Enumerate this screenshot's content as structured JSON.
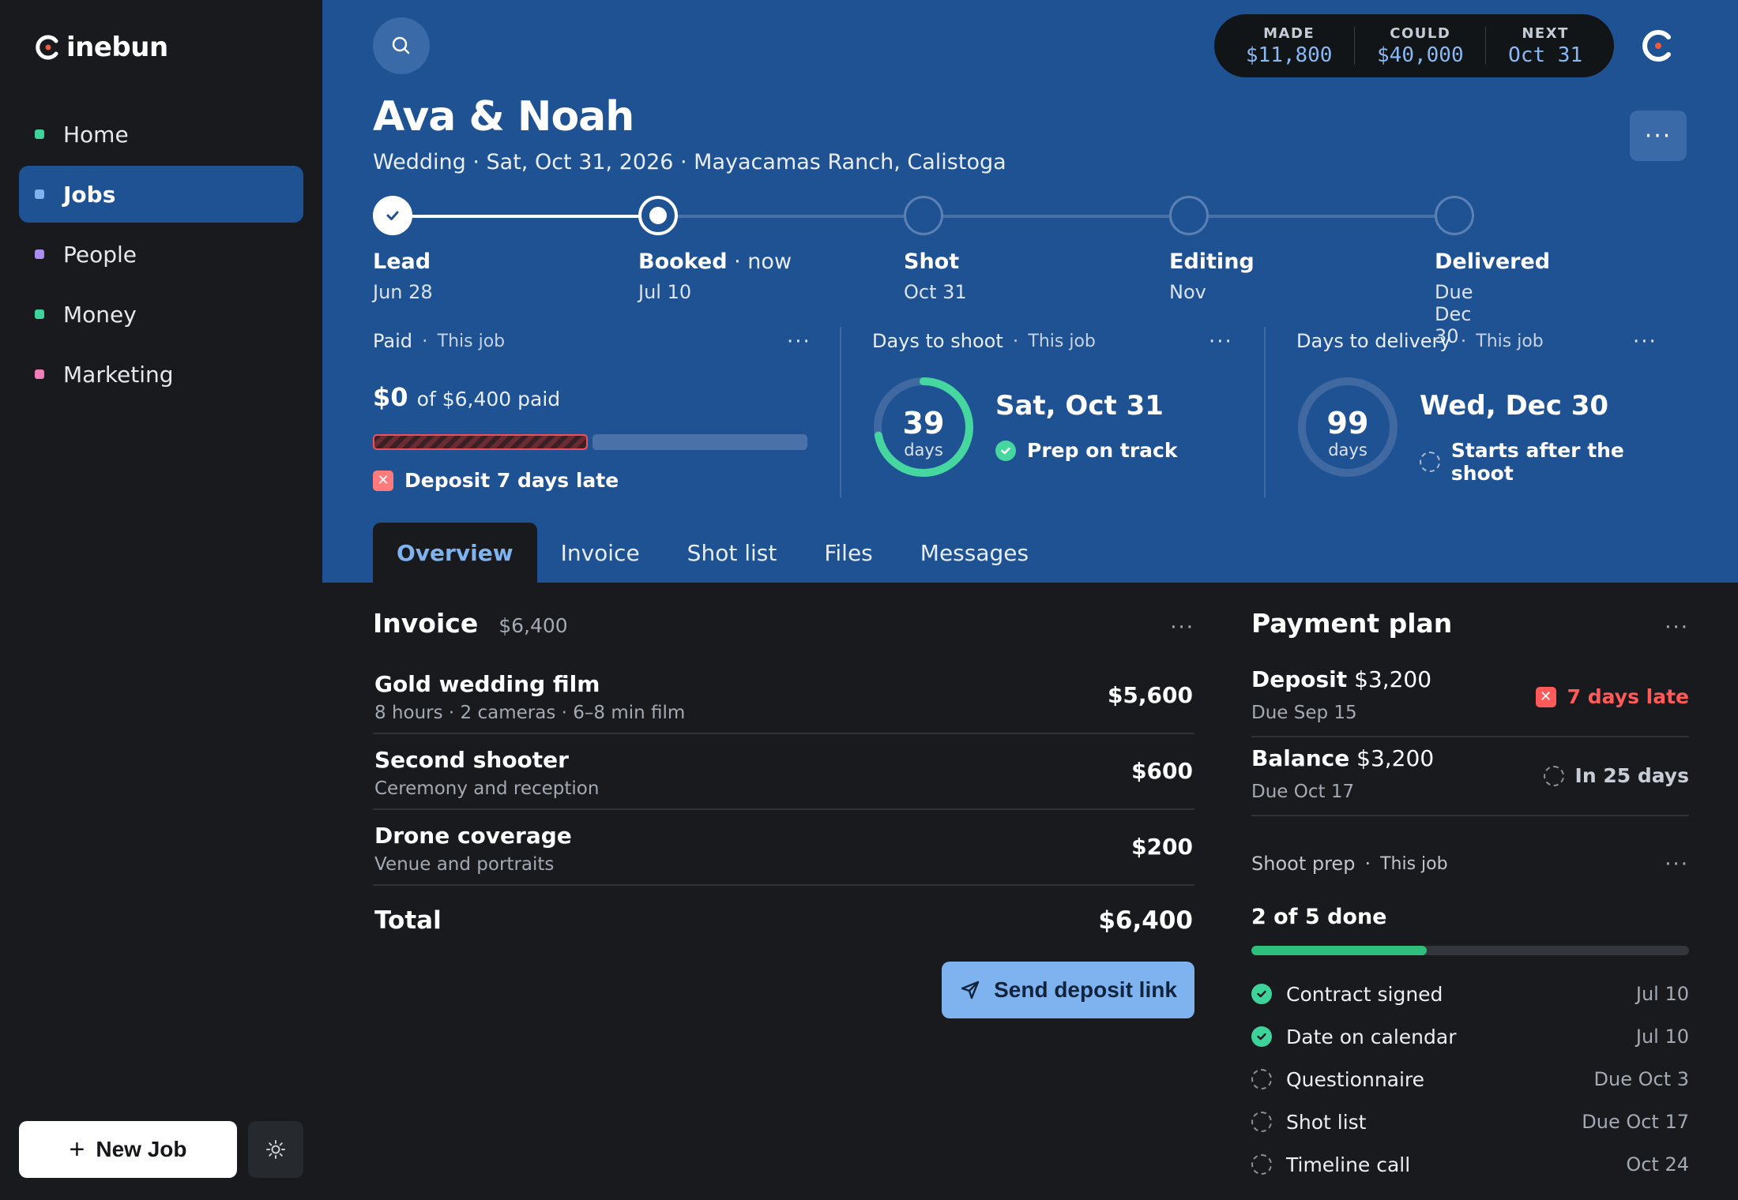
{
  "app": {
    "name": "inebun"
  },
  "sidebar": {
    "items": [
      {
        "label": "Home",
        "color": "#3ed39a",
        "active": false
      },
      {
        "label": "Jobs",
        "color": "#7fb3f0",
        "active": true
      },
      {
        "label": "People",
        "color": "#a98df0",
        "active": false
      },
      {
        "label": "Money",
        "color": "#3ed39a",
        "active": false
      },
      {
        "label": "Marketing",
        "color": "#f07fb8",
        "active": false
      }
    ],
    "new_job_label": "New Job"
  },
  "stats": {
    "made": {
      "label": "MADE",
      "value": "$11,800"
    },
    "could": {
      "label": "COULD",
      "value": "$40,000"
    },
    "next": {
      "label": "NEXT",
      "value": "Oct 31"
    }
  },
  "job": {
    "client": "Ava & Noah",
    "subtitle": "Wedding · Sat, Oct 31, 2026 · Mayacamas Ranch, Calistoga"
  },
  "steps": [
    {
      "label": "Lead",
      "suffix": "",
      "date": "Jun 28",
      "state": "done"
    },
    {
      "label": "Booked",
      "suffix": " · now",
      "date": "Jul 10",
      "state": "current"
    },
    {
      "label": "Shot",
      "suffix": "",
      "date": "Oct 31",
      "state": "todo"
    },
    {
      "label": "Editing",
      "suffix": "",
      "date": "Nov",
      "state": "todo"
    },
    {
      "label": "Delivered",
      "suffix": "",
      "date": "Due Dec 30",
      "state": "todo"
    }
  ],
  "cards": {
    "paid": {
      "title": "Paid",
      "scope": "This job",
      "amount": "$0",
      "of_text": "of $6,400 paid",
      "paid_fraction": 0,
      "late_text": "Deposit 7 days late"
    },
    "shoot": {
      "title": "Days to shoot",
      "scope": "This job",
      "days": "39",
      "unit": "days",
      "progress": 0.72,
      "date": "Sat, Oct 31",
      "status": "Prep on track"
    },
    "delivery": {
      "title": "Days to delivery",
      "scope": "This job",
      "days": "99",
      "unit": "days",
      "progress": 0,
      "date": "Wed, Dec 30",
      "status": "Starts after the shoot"
    }
  },
  "tabs": [
    "Overview",
    "Invoice",
    "Shot list",
    "Files",
    "Messages"
  ],
  "invoice": {
    "title": "Invoice",
    "amount": "$6,400",
    "items": [
      {
        "name": "Gold wedding film",
        "desc": "8 hours · 2 cameras · 6–8 min film",
        "price": "$5,600"
      },
      {
        "name": "Second shooter",
        "desc": "Ceremony and reception",
        "price": "$600"
      },
      {
        "name": "Drone coverage",
        "desc": "Venue and portraits",
        "price": "$200"
      }
    ],
    "total_label": "Total",
    "total": "$6,400",
    "send_label": "Send deposit link"
  },
  "payment_plan": {
    "title": "Payment plan",
    "rows": [
      {
        "name": "Deposit",
        "amount": "$3,200",
        "due": "Due Sep 15",
        "status": "7 days late",
        "kind": "late"
      },
      {
        "name": "Balance",
        "amount": "$3,200",
        "due": "Due Oct 17",
        "status": "In 25 days",
        "kind": "soon"
      }
    ]
  },
  "prep": {
    "title": "Shoot prep",
    "scope": "This job",
    "count": "2 of 5 done",
    "progress": 0.4,
    "items": [
      {
        "name": "Contract signed",
        "date": "Jul 10",
        "done": true
      },
      {
        "name": "Date on calendar",
        "date": "Jul 10",
        "done": true
      },
      {
        "name": "Questionnaire",
        "date": "Due Oct 3",
        "done": false
      },
      {
        "name": "Shot list",
        "date": "Due Oct 17",
        "done": false
      },
      {
        "name": "Timeline call",
        "date": "Oct 24",
        "done": false
      }
    ]
  }
}
